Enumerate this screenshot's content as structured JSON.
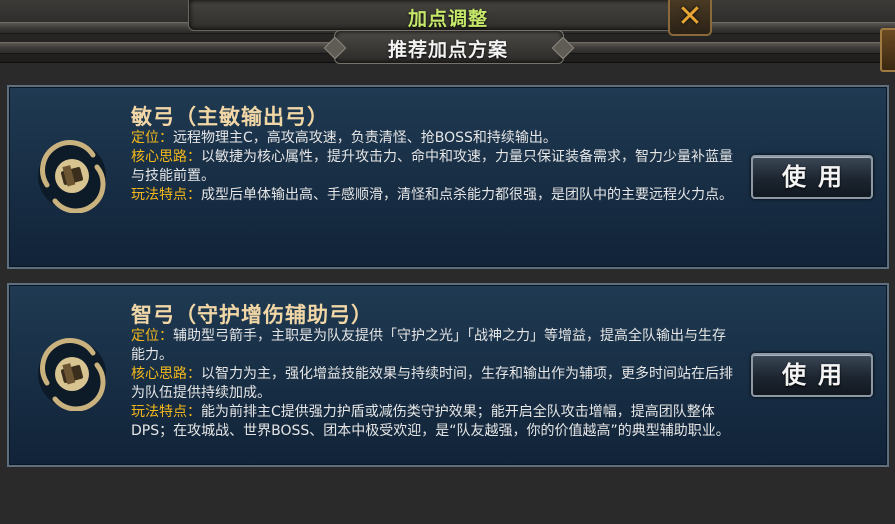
{
  "window": {
    "title": "加点调整",
    "subtitle": "推荐加点方案",
    "close_icon": "close-x-icon"
  },
  "colors": {
    "title_green": "#c6e86a",
    "card_title": "#f2d7a6",
    "label_gold": "#f3b71c",
    "card_bg": "#1a3249"
  },
  "plans": [
    {
      "icon": "bow-emblem-icon",
      "title": "敏弓（主敏输出弓）",
      "lines": [
        {
          "label": "定位：",
          "text": "远程物理主C，高攻高攻速，负责清怪、抢BOSS和持续输出。"
        },
        {
          "label": "核心思路：",
          "text": "以敏捷为核心属性，提升攻击力、命中和攻速，力量只保证装备需求，智力少量补蓝量与技能前置。"
        },
        {
          "label": "玩法特点：",
          "text": "成型后单体输出高、手感顺滑，清怪和点杀能力都很强，是团队中的主要远程火力点。"
        }
      ],
      "button": "使用"
    },
    {
      "icon": "bow-emblem-icon",
      "title": "智弓（守护增伤辅助弓）",
      "lines": [
        {
          "label": "定位：",
          "text": "辅助型弓箭手，主职是为队友提供「守护之光」「战神之力」等增益，提高全队输出与生存能力。"
        },
        {
          "label": "核心思路：",
          "text": "以智力为主，强化增益技能效果与持续时间，生存和输出作为辅项，更多时间站在后排为队伍提供持续加成。"
        },
        {
          "label": "玩法特点：",
          "text": "能为前排主C提供强力护盾或减伤类守护效果；能开启全队攻击增幅，提高团队整体DPS；在攻城战、世界BOSS、团本中极受欢迎，是“队友越强，你的价值越高”的典型辅助职业。"
        }
      ],
      "button": "使用"
    }
  ]
}
